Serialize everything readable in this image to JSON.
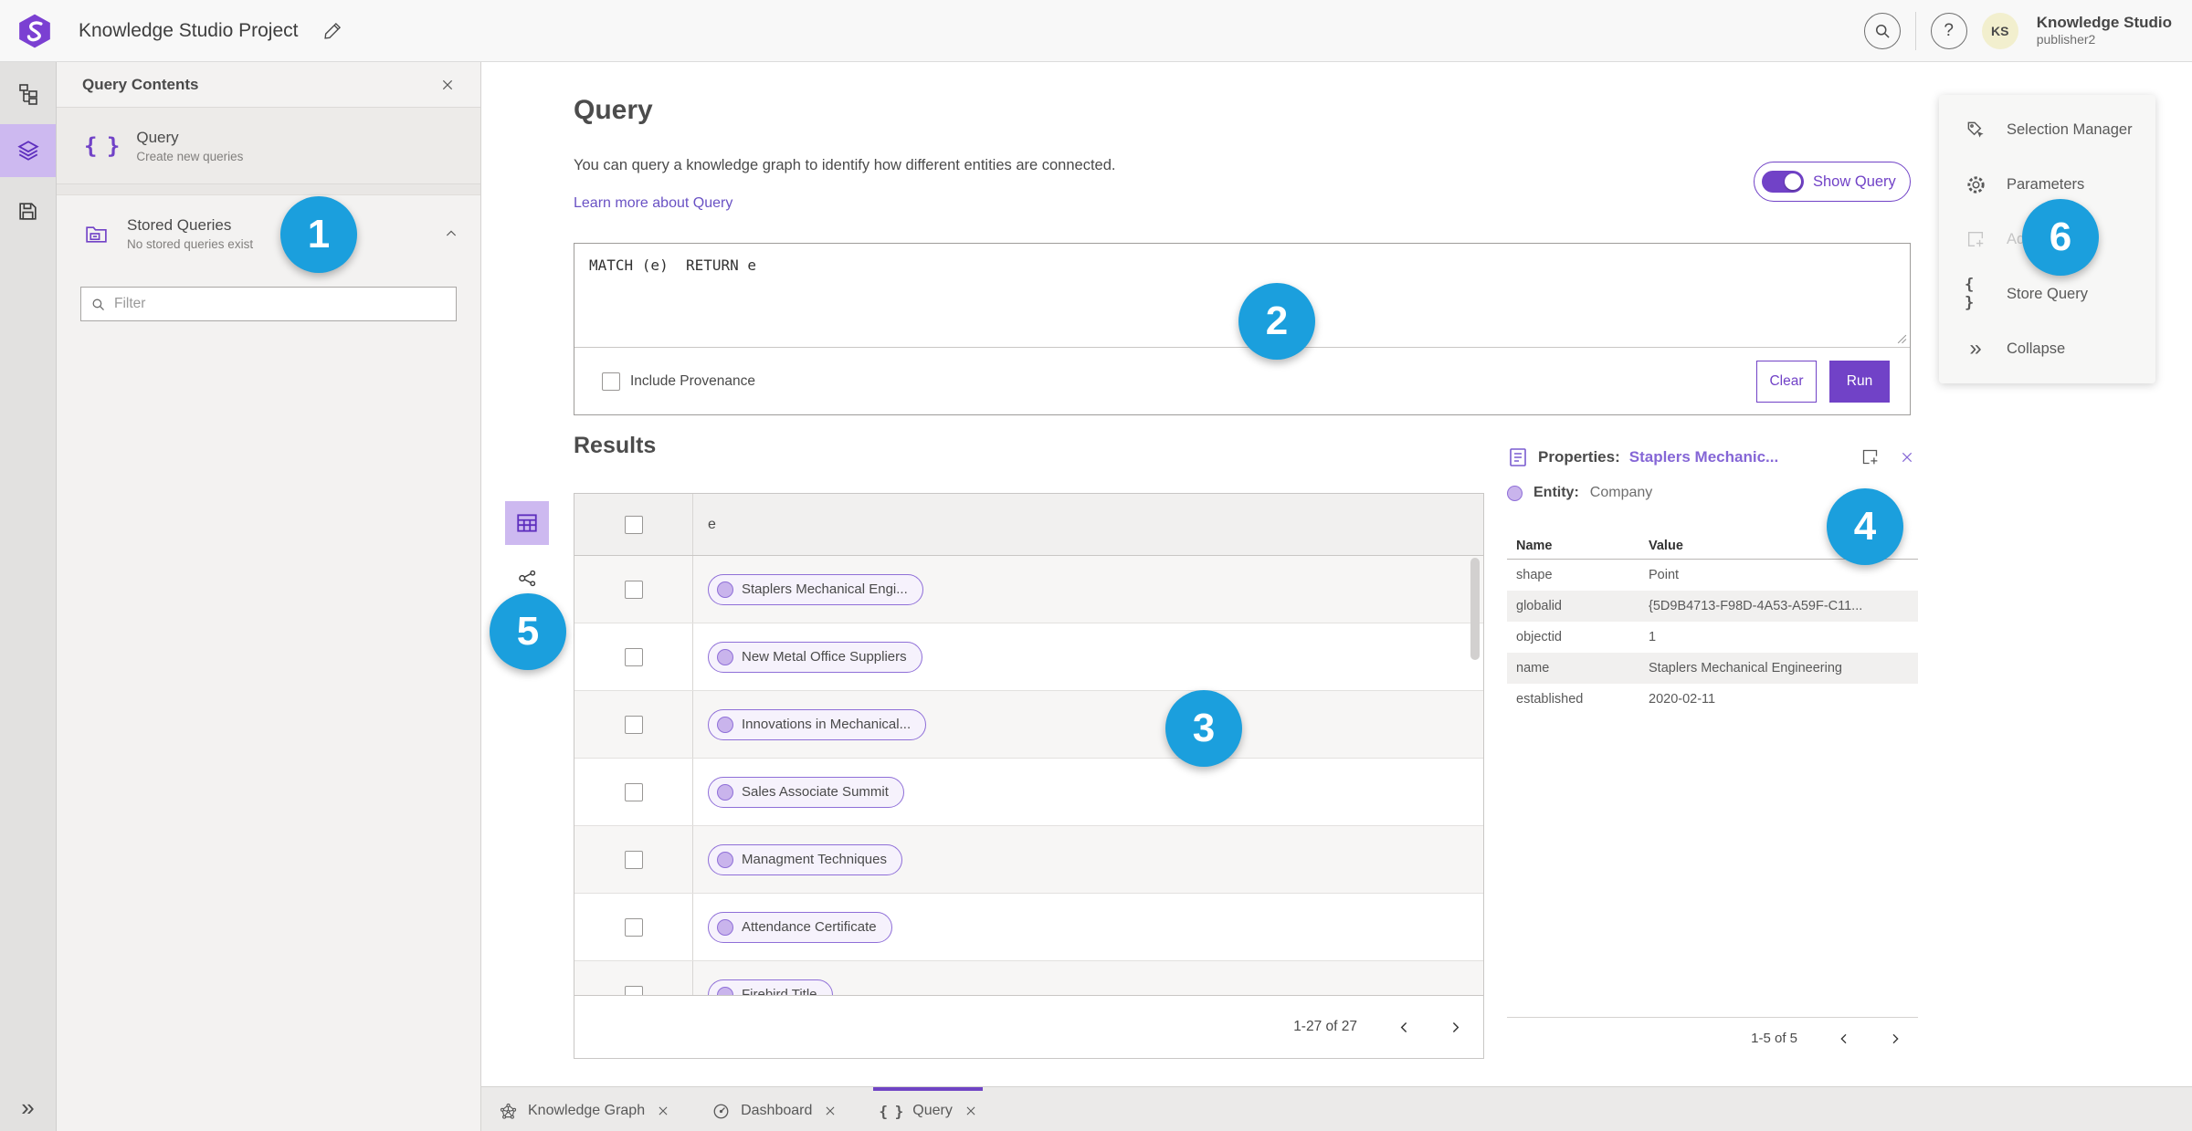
{
  "topbar": {
    "title": "Knowledge Studio Project",
    "avatar_initials": "KS",
    "user_name": "Knowledge Studio",
    "user_role": "publisher2"
  },
  "contents_panel": {
    "title": "Query Contents",
    "items": [
      {
        "label": "Query",
        "sublabel": "Create new queries"
      },
      {
        "label": "Stored Queries",
        "sublabel": "No stored queries exist"
      }
    ],
    "filter_placeholder": "Filter"
  },
  "query_section": {
    "title": "Query",
    "description": "You can query a knowledge graph to identify how different entities are connected.",
    "learn_more_label": "Learn more about Query",
    "show_query_label": "Show Query",
    "show_query_on": true,
    "query_text": "MATCH (e)  RETURN e",
    "include_provenance_label": "Include Provenance",
    "include_provenance_checked": false,
    "clear_label": "Clear",
    "run_label": "Run"
  },
  "results": {
    "title": "Results",
    "column_header": "e",
    "rows": [
      "Staplers Mechanical Engi...",
      "New Metal Office Suppliers",
      "Innovations in Mechanical...",
      "Sales Associate Summit",
      "Managment Techniques",
      "Attendance Certificate",
      "Firebird Title"
    ],
    "pagination": "1-27 of 27"
  },
  "properties_panel": {
    "title_label": "Properties:",
    "title_link": "Staplers Mechanic...",
    "entity_label": "Entity:",
    "entity_value": "Company",
    "headers": [
      "Name",
      "Value"
    ],
    "rows": [
      [
        "shape",
        "Point"
      ],
      [
        "globalid",
        "{5D9B4713-F98D-4A53-A59F-C11..."
      ],
      [
        "objectid",
        "1"
      ],
      [
        "name",
        "Staplers Mechanical Engineering"
      ],
      [
        "established",
        "2020-02-11"
      ]
    ],
    "pagination": "1-5 of 5"
  },
  "right_menu": {
    "items": [
      {
        "label": "Selection Manager",
        "disabled": false
      },
      {
        "label": "Parameters",
        "disabled": false
      },
      {
        "label": "Add",
        "disabled": true
      },
      {
        "label": "Store Query",
        "disabled": false
      },
      {
        "label": "Collapse",
        "disabled": false
      }
    ]
  },
  "bottom_tabs": [
    {
      "label": "Knowledge Graph",
      "active": false
    },
    {
      "label": "Dashboard",
      "active": false
    },
    {
      "label": "Query",
      "active": true
    }
  ],
  "annotations": [
    "1",
    "2",
    "3",
    "4",
    "5",
    "6"
  ],
  "icons": {
    "braces": "{ }",
    "help_glyph": "?",
    "collapse_glyph": "»",
    "expand_glyph": "»"
  },
  "colors": {
    "accent_purple": "#7142c7",
    "link_purple": "#6a52c4",
    "annotation_blue": "#1b9fdd",
    "pill_border": "#8f6fd8",
    "rail_selected_bg": "#cdb9f0"
  }
}
